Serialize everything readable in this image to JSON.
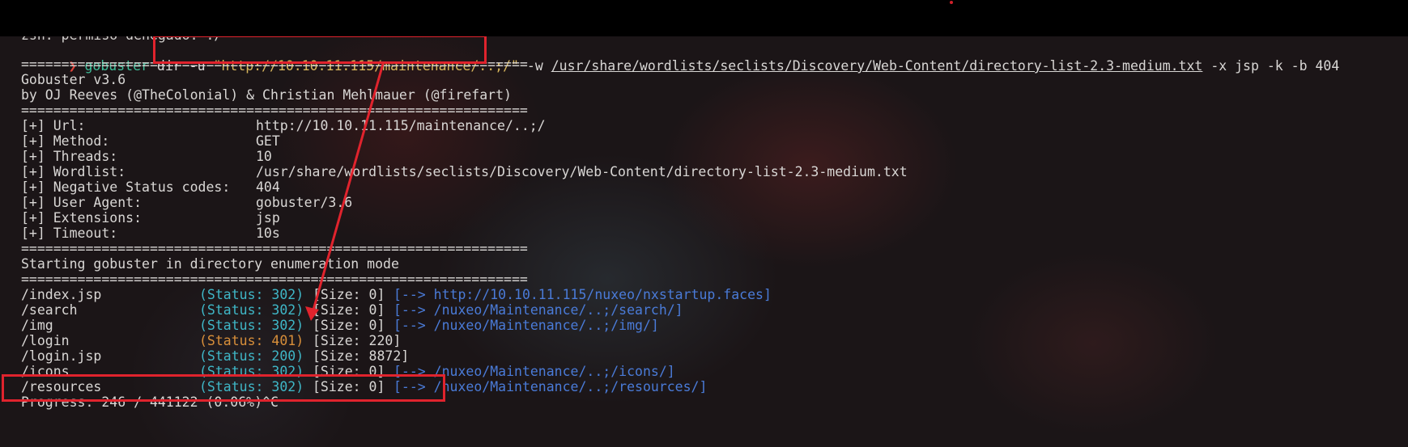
{
  "prev_line": "zsh: permiso denegado: ./",
  "command": {
    "prompt": "❯",
    "tool": "gobuster",
    "subcmd": "dir",
    "url_flag": "-u",
    "url": "\"http://10.10.11.115/maintenance/..;/\"",
    "wordlist_flag": "-w",
    "wordlist": "/usr/share/wordlists/seclists/Discovery/Web-Content/directory-list-2.3-medium.txt",
    "rest": "-x jsp -k -b 404"
  },
  "separator": "===============================================================",
  "banner": {
    "version": "Gobuster v3.6",
    "authors": "by OJ Reeves (@TheColonial) & Christian Mehlmauer (@firefart)"
  },
  "config": [
    {
      "key": "[+] Url:",
      "value": "http://10.10.11.115/maintenance/..;/"
    },
    {
      "key": "[+] Method:",
      "value": "GET"
    },
    {
      "key": "[+] Threads:",
      "value": "10"
    },
    {
      "key": "[+] Wordlist:",
      "value": "/usr/share/wordlists/seclists/Discovery/Web-Content/directory-list-2.3-medium.txt"
    },
    {
      "key": "[+] Negative Status codes:",
      "value": "404"
    },
    {
      "key": "[+] User Agent:",
      "value": "gobuster/3.6"
    },
    {
      "key": "[+] Extensions:",
      "value": "jsp"
    },
    {
      "key": "[+] Timeout:",
      "value": "10s"
    }
  ],
  "start_message": "Starting gobuster in directory enumeration mode",
  "results": [
    {
      "path": "/index.jsp",
      "status": "(Status: 302)",
      "size": "[Size: 0]",
      "redirect": "[--> http://10.10.11.115/nuxeo/nxstartup.faces]"
    },
    {
      "path": "/search",
      "status": "(Status: 302)",
      "size": "[Size: 0]",
      "redirect": "[--> /nuxeo/Maintenance/..;/search/]"
    },
    {
      "path": "/img",
      "status": "(Status: 302)",
      "size": "[Size: 0]",
      "redirect": "[--> /nuxeo/Maintenance/..;/img/]"
    },
    {
      "path": "/login",
      "status": "(Status: 401)",
      "size": "[Size: 220]",
      "redirect": ""
    },
    {
      "path": "/login.jsp",
      "status": "(Status: 200)",
      "size": "[Size: 8872]",
      "redirect": ""
    },
    {
      "path": "/icons",
      "status": "(Status: 302)",
      "size": "[Size: 0]",
      "redirect": "[--> /nuxeo/Maintenance/..;/icons/]"
    },
    {
      "path": "/resources",
      "status": "(Status: 302)",
      "size": "[Size: 0]",
      "redirect": "[--> /nuxeo/Maintenance/..;/resources/]"
    }
  ],
  "progress": "Progress: 246 / 441122 (0.06%)^C",
  "colors": {
    "annotation_red": "#e0232d",
    "status_ok": "#3fb7c7",
    "status_401": "#d88f3a",
    "redirect": "#4a7bd8",
    "command": "#3fbf9a",
    "string": "#d8b65c"
  }
}
